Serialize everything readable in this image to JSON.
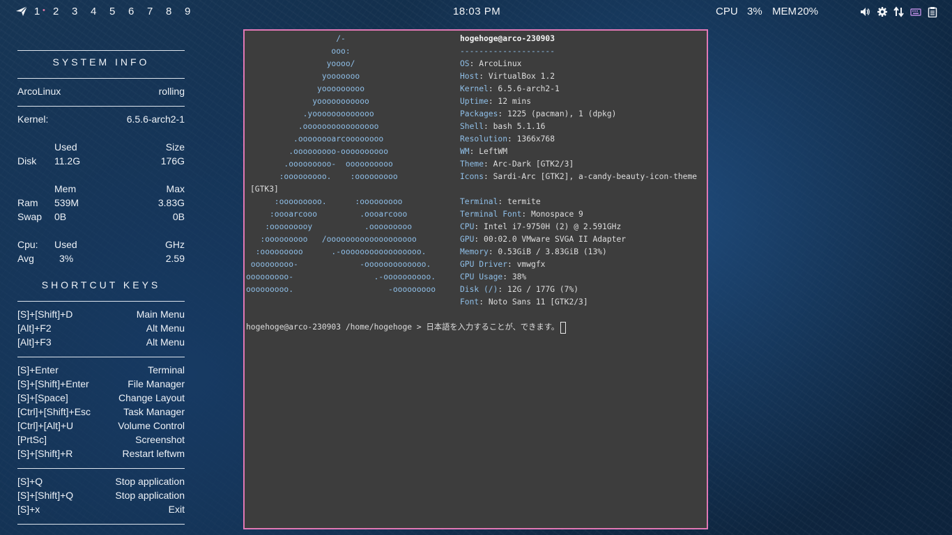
{
  "topbar": {
    "workspaces": [
      "1",
      "2",
      "3",
      "4",
      "5",
      "6",
      "7",
      "8",
      "9"
    ],
    "active_workspace": "1",
    "clock": "18:03 PM",
    "cpu_label": "CPU",
    "cpu_value": "3%",
    "mem_label": "MEM",
    "mem_value": "20%",
    "tray_icons": [
      "volume-icon",
      "settings-icon",
      "network-icon",
      "keyboard-icon",
      "clipboard-icon"
    ],
    "accent_color": "#e07aa8"
  },
  "conky": {
    "system_heading": "SYSTEM INFO",
    "distro": "ArcoLinux",
    "release": "rolling",
    "kernel_label": "Kernel:",
    "kernel": "6.5.6-arch2-1",
    "disk_used_header": "Used",
    "disk_size_header": "Size",
    "disk_label": "Disk",
    "disk_used": "11.2G",
    "disk_size": "176G",
    "mem_header": "Mem",
    "max_header": "Max",
    "ram_label": "Ram",
    "ram_used": "539M",
    "ram_max": "3.83G",
    "swap_label": "Swap",
    "swap_used": "0B",
    "swap_max": "0B",
    "cpu_label": "Cpu:",
    "cpu_used_header": "Used",
    "cpu_ghz_header": "GHz",
    "avg_label": "Avg",
    "cpu_avg": "3%",
    "cpu_ghz": "2.59",
    "shortcut_heading": "SHORTCUT KEYS",
    "shortcut_groups": [
      [
        {
          "keys": "[S]+[Shift]+D",
          "action": "Main Menu"
        },
        {
          "keys": "[Alt]+F2",
          "action": "Alt Menu"
        },
        {
          "keys": "[Alt]+F3",
          "action": "Alt Menu"
        }
      ],
      [
        {
          "keys": "[S]+Enter",
          "action": "Terminal"
        },
        {
          "keys": "[S]+[Shift]+Enter",
          "action": "File Manager"
        },
        {
          "keys": "[S]+[Space]",
          "action": "Change Layout"
        },
        {
          "keys": "[Ctrl]+[Shift]+Esc",
          "action": "Task Manager"
        },
        {
          "keys": "[Ctrl]+[Alt]+U",
          "action": "Volume Control"
        },
        {
          "keys": "[PrtSc]",
          "action": "Screenshot"
        },
        {
          "keys": "[S]+[Shift]+R",
          "action": "Restart leftwm"
        }
      ],
      [
        {
          "keys": "[S]+Q",
          "action": "Stop application"
        },
        {
          "keys": "[S]+[Shift]+Q",
          "action": "Stop application"
        },
        {
          "keys": "[S]+x",
          "action": "Exit"
        }
      ]
    ]
  },
  "terminal": {
    "ascii_art": [
      "                   /-",
      "                  ooo:",
      "                 yoooo/",
      "                yooooooo",
      "               yooooooooo",
      "              yooooooooooo",
      "            .yooooooooooooo",
      "           .oooooooooooooooo",
      "          .oooooooarcoooooooo",
      "         .ooooooooo-oooooooooo",
      "        .ooooooooo-  oooooooooo",
      "       :ooooooooo.    :ooooooooo",
      "",
      "      :ooooooooo.      :ooooooooo",
      "     :oooarcooo         .oooarcooo",
      "    :ooooooooy           .ooooooooo",
      "   :ooooooooo   /ooooooooooooooooooo",
      "  :ooooooooo      .-ooooooooooooooooo.",
      " ooooooooo-             -ooooooooooooo.",
      "ooooooooo-                 .-oooooooooo.",
      "ooooooooo.                    -ooooooooo"
    ],
    "user_host": "hogehoge@arco-230903",
    "separator": "--------------------",
    "fields": [
      {
        "key": "OS",
        "value": "ArcoLinux"
      },
      {
        "key": "Host",
        "value": "VirtualBox 1.2"
      },
      {
        "key": "Kernel",
        "value": "6.5.6-arch2-1"
      },
      {
        "key": "Uptime",
        "value": "12 mins"
      },
      {
        "key": "Packages",
        "value": "1225 (pacman), 1 (dpkg)"
      },
      {
        "key": "Shell",
        "value": "bash 5.1.16"
      },
      {
        "key": "Resolution",
        "value": "1366x768"
      },
      {
        "key": "WM",
        "value": "LeftWM"
      },
      {
        "key": "Theme",
        "value": "Arc-Dark [GTK2/3]"
      },
      {
        "key": "Icons",
        "value": "Sardi-Arc [GTK2], a-candy-beauty-icon-theme"
      }
    ],
    "icons_wrap": "[GTK3]",
    "fields2": [
      {
        "key": "Terminal",
        "value": "termite"
      },
      {
        "key": "Terminal Font",
        "value": "Monospace 9"
      },
      {
        "key": "CPU",
        "value": "Intel i7-9750H (2) @ 2.591GHz"
      },
      {
        "key": "GPU",
        "value": "00:02.0 VMware SVGA II Adapter"
      },
      {
        "key": "Memory",
        "value": "0.53GiB / 3.83GiB (13%)"
      },
      {
        "key": "GPU Driver",
        "value": "vmwgfx"
      },
      {
        "key": "CPU Usage",
        "value": "38%"
      },
      {
        "key": "Disk (/)",
        "value": "12G / 177G (7%)"
      },
      {
        "key": "Font",
        "value": "Noto Sans 11 [GTK2/3]"
      }
    ],
    "prompt": "hogehoge@arco-230903 /home/hogehoge >",
    "input": "日本語を入力することが、できます。",
    "border_color": "#e278b5",
    "label_color": "#8fbfe8"
  }
}
